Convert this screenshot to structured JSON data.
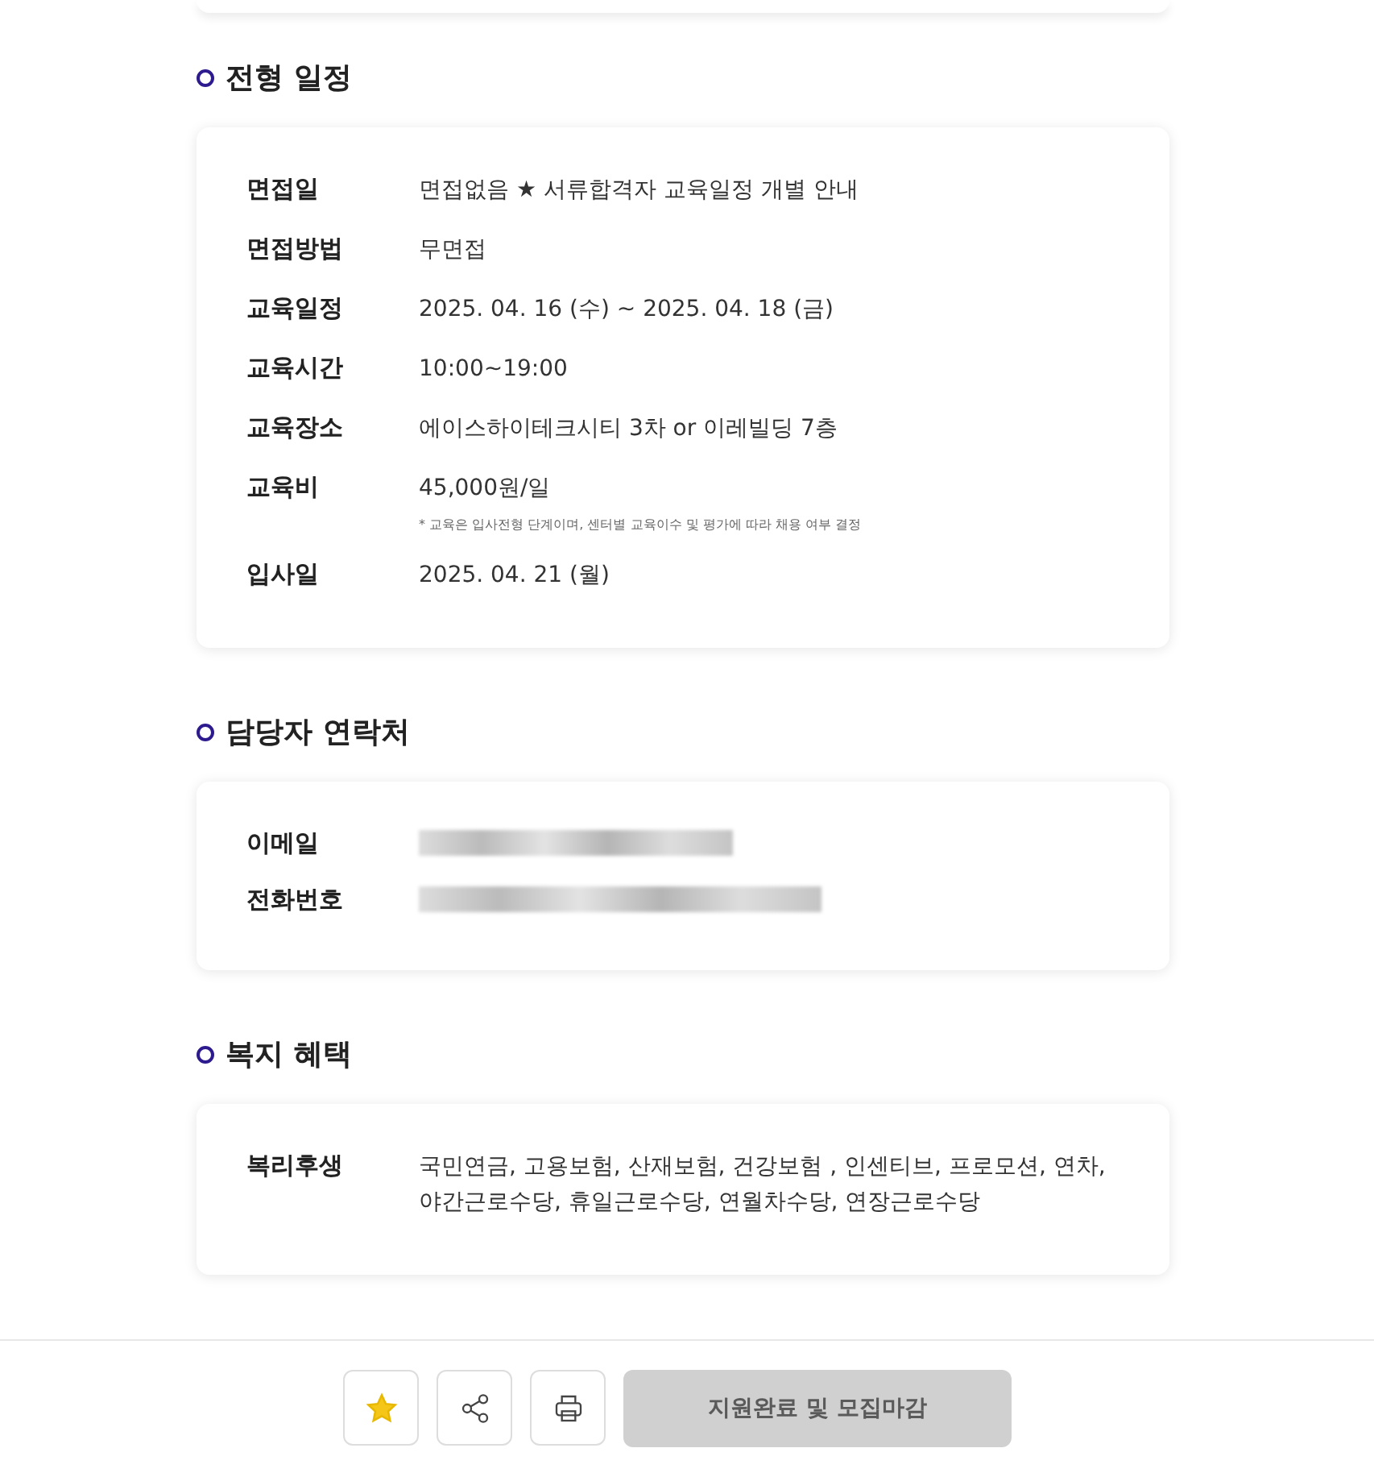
{
  "sections": [
    {
      "title": "전형 일정",
      "rows": [
        {
          "label": "면접일",
          "kind": "text",
          "value": "면접없음 ★ 서류합격자 교육일정 개별 안내"
        },
        {
          "label": "면접방법",
          "kind": "text",
          "value": "무면접"
        },
        {
          "label": "교육일정",
          "kind": "text",
          "value": "2025. 04. 16 (수) ~ 2025. 04. 18 (금)"
        },
        {
          "label": "교육시간",
          "kind": "text",
          "value": "10:00~19:00"
        },
        {
          "label": "교육장소",
          "kind": "text",
          "value": "에이스하이테크시티 3차 or 이레빌딩 7층"
        },
        {
          "label": "교육비",
          "kind": "text",
          "value": "45,000원/일",
          "note": "* 교육은 입사전형 단계이며, 센터별 교육이수 및 평가에 따라 채용 여부 결정"
        },
        {
          "label": "입사일",
          "kind": "text",
          "value": "2025. 04. 21 (월)"
        }
      ]
    },
    {
      "title": "담당자 연락처",
      "rows": [
        {
          "label": "이메일",
          "kind": "blurred"
        },
        {
          "label": "전화번호",
          "kind": "blurred"
        }
      ]
    },
    {
      "title": "복지 혜택",
      "rows": [
        {
          "label": "복리후생",
          "kind": "text",
          "value": "국민연금, 고용보험, 산재보험, 건강보험 , 인센티브, 프로모션, 연차, 야간근로수당, 휴일근로수당, 연월차수당, 연장근로수당"
        }
      ]
    }
  ],
  "footer": {
    "favorited": true,
    "apply_button": {
      "label": "지원완료 및 모집마감",
      "disabled": true
    }
  }
}
